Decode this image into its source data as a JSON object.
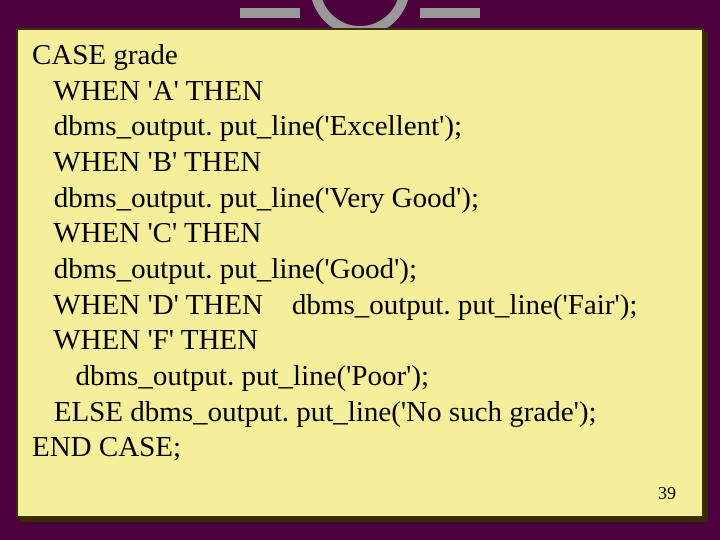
{
  "code": {
    "lines": [
      "CASE grade",
      "   WHEN 'A' THEN",
      "   dbms_output. put_line('Excellent');",
      "   WHEN 'B' THEN",
      "   dbms_output. put_line('Very Good');",
      "   WHEN 'C' THEN",
      "   dbms_output. put_line('Good');",
      "   WHEN 'D' THEN    dbms_output. put_line('Fair');",
      "   WHEN 'F' THEN",
      "      dbms_output. put_line('Poor');",
      "   ELSE dbms_output. put_line('No such grade');",
      "END CASE;"
    ]
  },
  "page_number": "39"
}
